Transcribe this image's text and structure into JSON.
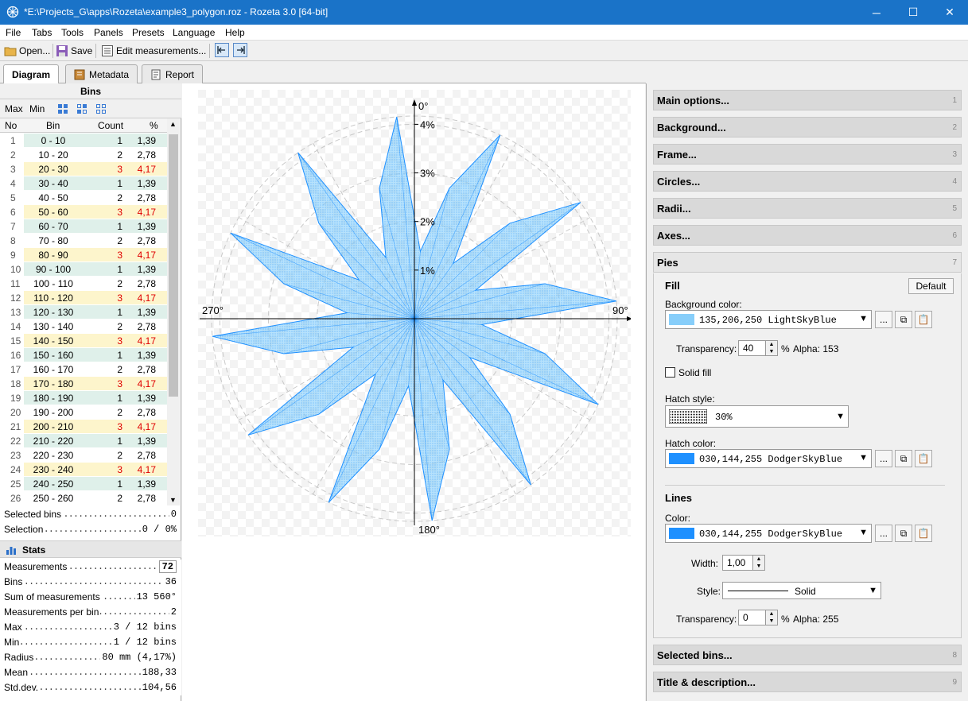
{
  "window": {
    "title": "*E:\\Projects_G\\apps\\Rozeta\\example3_polygon.roz - Rozeta 3.0  [64-bit]",
    "minimize": "─",
    "maximize": "☐",
    "close": "✕"
  },
  "menu": [
    "File",
    "Tabs",
    "Tools",
    "Panels",
    "Presets",
    "Language",
    "Help"
  ],
  "toolbar": {
    "open": "Open...",
    "save": "Save",
    "edit": "Edit measurements..."
  },
  "tabs": [
    "Diagram",
    "Metadata",
    "Report"
  ],
  "bins": {
    "title": "Bins",
    "max": "Max",
    "min": "Min",
    "columns": [
      "No",
      "Bin",
      "Count",
      "%"
    ],
    "rows": [
      {
        "no": "1",
        "bin": "0 - 10",
        "count": "1",
        "pct": "1,39"
      },
      {
        "no": "2",
        "bin": "10 - 20",
        "count": "2",
        "pct": "2,78"
      },
      {
        "no": "3",
        "bin": "20 - 30",
        "count": "3",
        "pct": "4,17"
      },
      {
        "no": "4",
        "bin": "30 - 40",
        "count": "1",
        "pct": "1,39"
      },
      {
        "no": "5",
        "bin": "40 - 50",
        "count": "2",
        "pct": "2,78"
      },
      {
        "no": "6",
        "bin": "50 - 60",
        "count": "3",
        "pct": "4,17"
      },
      {
        "no": "7",
        "bin": "60 - 70",
        "count": "1",
        "pct": "1,39"
      },
      {
        "no": "8",
        "bin": "70 - 80",
        "count": "2",
        "pct": "2,78"
      },
      {
        "no": "9",
        "bin": "80 - 90",
        "count": "3",
        "pct": "4,17"
      },
      {
        "no": "10",
        "bin": "90 - 100",
        "count": "1",
        "pct": "1,39"
      },
      {
        "no": "11",
        "bin": "100 - 110",
        "count": "2",
        "pct": "2,78"
      },
      {
        "no": "12",
        "bin": "110 - 120",
        "count": "3",
        "pct": "4,17"
      },
      {
        "no": "13",
        "bin": "120 - 130",
        "count": "1",
        "pct": "1,39"
      },
      {
        "no": "14",
        "bin": "130 - 140",
        "count": "2",
        "pct": "2,78"
      },
      {
        "no": "15",
        "bin": "140 - 150",
        "count": "3",
        "pct": "4,17"
      },
      {
        "no": "16",
        "bin": "150 - 160",
        "count": "1",
        "pct": "1,39"
      },
      {
        "no": "17",
        "bin": "160 - 170",
        "count": "2",
        "pct": "2,78"
      },
      {
        "no": "18",
        "bin": "170 - 180",
        "count": "3",
        "pct": "4,17"
      },
      {
        "no": "19",
        "bin": "180 - 190",
        "count": "1",
        "pct": "1,39"
      },
      {
        "no": "20",
        "bin": "190 - 200",
        "count": "2",
        "pct": "2,78"
      },
      {
        "no": "21",
        "bin": "200 - 210",
        "count": "3",
        "pct": "4,17"
      },
      {
        "no": "22",
        "bin": "210 - 220",
        "count": "1",
        "pct": "1,39"
      },
      {
        "no": "23",
        "bin": "220 - 230",
        "count": "2",
        "pct": "2,78"
      },
      {
        "no": "24",
        "bin": "230 - 240",
        "count": "3",
        "pct": "4,17"
      },
      {
        "no": "25",
        "bin": "240 - 250",
        "count": "1",
        "pct": "1,39"
      },
      {
        "no": "26",
        "bin": "250 - 260",
        "count": "2",
        "pct": "2,78"
      }
    ],
    "row_colors": {
      "1": "#dff0ea",
      "2": "#ffffff",
      "3": "#fdf5cc"
    },
    "high_text_color": "#e00000",
    "selected_label": "Selected bins",
    "selected_value": "0",
    "selection_label": "Selection",
    "selection_value": "0 / 0%"
  },
  "stats": {
    "title": "Stats",
    "items": [
      {
        "label": "Measurements",
        "value": "72"
      },
      {
        "label": "Bins",
        "value": "36"
      },
      {
        "label": "Sum of measurements",
        "value": "13 560°"
      },
      {
        "label": "Measurements per bin",
        "value": "2"
      },
      {
        "label": "Max",
        "value": "3 / 12 bins"
      },
      {
        "label": "Min",
        "value": "1 / 12 bins"
      },
      {
        "label": "Radius",
        "value": "80 mm (4,17%)"
      },
      {
        "label": "Mean",
        "value": "188,33"
      },
      {
        "label": "Std.dev.",
        "value": "104,56"
      }
    ]
  },
  "chart_data": {
    "type": "polar-rose",
    "bin_width_deg": 10,
    "values_pct": [
      1.39,
      2.78,
      4.17,
      1.39,
      2.78,
      4.17,
      1.39,
      2.78,
      4.17,
      1.39,
      2.78,
      4.17,
      1.39,
      2.78,
      4.17,
      1.39,
      2.78,
      4.17,
      1.39,
      2.78,
      4.17,
      1.39,
      2.78,
      4.17,
      1.39,
      2.78,
      4.17,
      1.39,
      2.78,
      4.17,
      1.39,
      2.78,
      4.17,
      1.39,
      2.78,
      4.17
    ],
    "rmax_pct": 4.17,
    "circle_labels": [
      "1%",
      "2%",
      "3%",
      "4%"
    ],
    "circle_values": [
      1,
      2,
      3,
      4
    ],
    "direction_labels": {
      "n": "0°",
      "e": "90°",
      "s": "180°",
      "w": "270°"
    },
    "fill_color": "#87cefa",
    "line_color": "#1e90ff",
    "grid": true
  },
  "panels": {
    "sections": [
      {
        "label": "Main options...",
        "num": "1"
      },
      {
        "label": "Background...",
        "num": "2"
      },
      {
        "label": "Frame...",
        "num": "3"
      },
      {
        "label": "Circles...",
        "num": "4"
      },
      {
        "label": "Radii...",
        "num": "5"
      },
      {
        "label": "Axes...",
        "num": "6"
      },
      {
        "label": "Pies",
        "num": "7"
      },
      {
        "label": "Selected bins...",
        "num": "8"
      },
      {
        "label": "Title & description...",
        "num": "9"
      }
    ],
    "pies": {
      "fill_heading": "Fill",
      "default_btn": "Default",
      "bg_color_label": "Background color:",
      "bg_color_value": "135,206,250   LightSkyBlue",
      "bg_swatch": "#87cefa",
      "transparency_label": "Transparency:",
      "transparency_value": "40",
      "pct": "%",
      "alpha1": "Alpha: 153",
      "solid_fill": "Solid fill",
      "hatch_style_label": "Hatch style:",
      "hatch_style_value": "30%",
      "hatch_color_label": "Hatch color:",
      "hatch_color_value": "030,144,255   DodgerSkyBlue",
      "hatch_swatch": "#1e90ff",
      "lines_heading": "Lines",
      "color_label": "Color:",
      "line_color_value": "030,144,255   DodgerSkyBlue",
      "line_swatch": "#1e90ff",
      "width_label": "Width:",
      "width_value": "1,00",
      "style_label": "Style:",
      "style_value": "Solid",
      "transparency2_value": "0",
      "alpha2": "Alpha: 255",
      "dots_btn": "..."
    }
  }
}
